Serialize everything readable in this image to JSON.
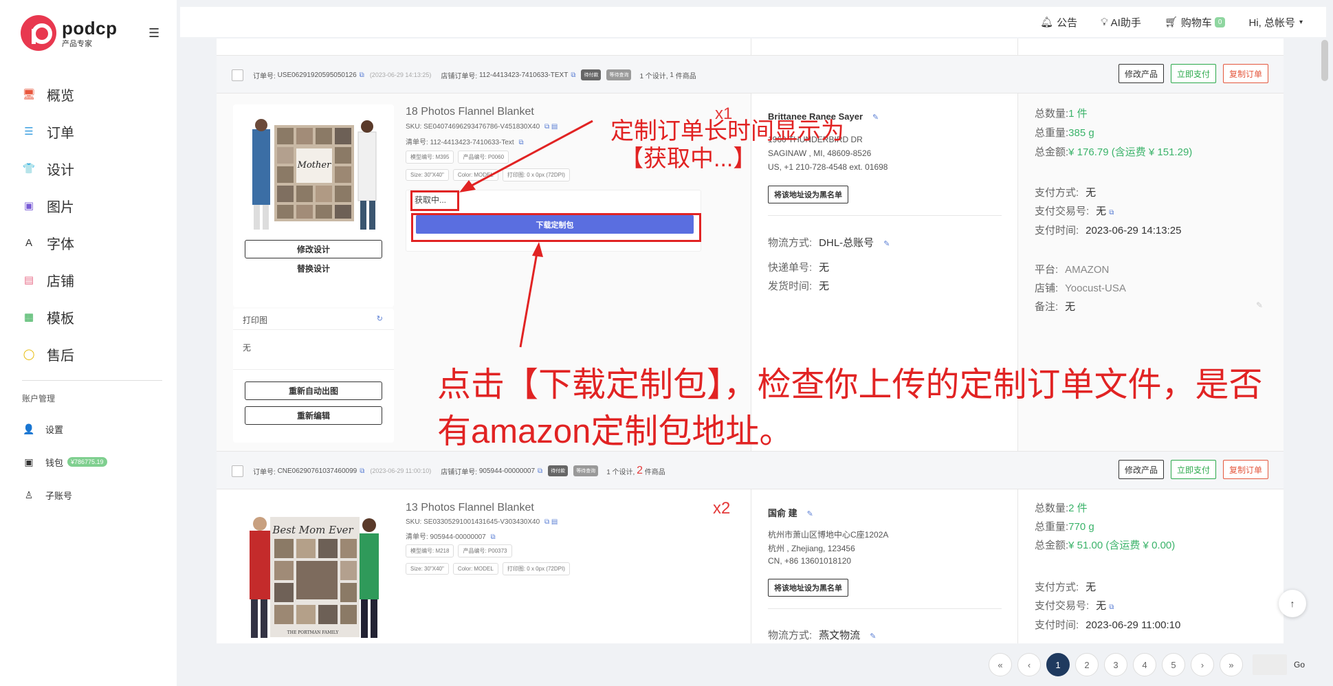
{
  "app": {
    "name": "podcp",
    "subtitle": "产品专家"
  },
  "sidebar": {
    "items": [
      {
        "label": "概览",
        "icon": "monitor-icon",
        "color": "#e8573d"
      },
      {
        "label": "订单",
        "icon": "list-icon",
        "color": "#3b9fe0"
      },
      {
        "label": "设计",
        "icon": "shirt-icon",
        "color": "#e0432d"
      },
      {
        "label": "图片",
        "icon": "image-icon",
        "color": "#7a5cd6"
      },
      {
        "label": "字体",
        "icon": "font-icon",
        "color": "#333333"
      },
      {
        "label": "店铺",
        "icon": "store-icon",
        "color": "#e86f8a"
      },
      {
        "label": "模板",
        "icon": "template-icon",
        "color": "#2aa84a"
      },
      {
        "label": "售后",
        "icon": "chat-icon",
        "color": "#e6b800"
      }
    ],
    "account_title": "账户管理",
    "account_items": [
      {
        "label": "设置",
        "icon": "user-icon"
      },
      {
        "label": "钱包",
        "icon": "wallet-icon",
        "badge": "¥786775.19"
      },
      {
        "label": "子账号",
        "icon": "sub-account-icon"
      }
    ]
  },
  "header": {
    "notice": "公告",
    "ai": "AI助手",
    "cart": "购物车",
    "cart_count": "0",
    "user": "Hi, 总帐号"
  },
  "orders": [
    {
      "order_no_label": "订单号:",
      "order_no": "USE06291920595050126",
      "time": "(2023-06-29 14:13:25)",
      "store_order_label": "店铺订单号:",
      "store_order": "112-4413423-7410633-TEXT",
      "tag1": "待付款",
      "tag2": "等待查询",
      "design_count": "1 个设计,",
      "item_count": "1",
      "item_suffix": "件商品",
      "btn_edit": "修改产品",
      "btn_pay": "立即支付",
      "btn_copy": "复制订单",
      "product": {
        "title": "18 Photos Flannel Blanket",
        "sku": "SKU: SE04074696293476786-V451830X40",
        "list_no": "清单号: 112-4413423-7410633-Text",
        "template_no": "模型编号: M395",
        "product_no": "产品编号: P0060",
        "size": "Size: 30\"X40\"",
        "color": "Color: MODEL",
        "print": "打印图: 0 x 0px (72DPI)",
        "qty": "x1",
        "fetching": "获取中...",
        "download": "下载定制包",
        "edit_design": "修改设计",
        "replace_design": "替换设计",
        "print_image_label": "打印图",
        "print_image_value": "无",
        "regen": "重新自动出图",
        "reedit": "重新编辑"
      },
      "address": {
        "name": "Brittanee Ranee Sayer",
        "line1": "1960 THUNDERBIRD DR",
        "line2": "SAGINAW , MI, 48609-8526",
        "line3": "US, +1 210-728-4548 ext. 01698",
        "blacklist": "将该地址设为黑名单",
        "ship_label": "物流方式:",
        "ship_value": "DHL-总账号",
        "track_label": "快递单号:",
        "track_value": "无",
        "send_label": "发货时间:",
        "send_value": "无"
      },
      "summary": {
        "qty_label": "总数量:",
        "qty_value": "1 件",
        "weight_label": "总重量:",
        "weight_value": "385 g",
        "amount_label": "总金额:",
        "amount_value": "¥ 176.79",
        "shipping_value": "(含运费 ¥ 151.29)",
        "pay_method_label": "支付方式:",
        "pay_method_value": "无",
        "pay_tx_label": "支付交易号:",
        "pay_tx_value": "无",
        "pay_time_label": "支付时间:",
        "pay_time_value": "2023-06-29 14:13:25",
        "platform_label": "平台:",
        "platform_value": "AMAZON",
        "store_label": "店铺:",
        "store_value": "Yoocust-USA",
        "note_label": "备注:",
        "note_value": "无"
      }
    },
    {
      "order_no_label": "订单号:",
      "order_no": "CNE06290761037460099",
      "time": "(2023-06-29 11:00:10)",
      "store_order_label": "店铺订单号:",
      "store_order": "905944-00000007",
      "tag1": "待付款",
      "tag2": "等待查询",
      "design_count": "1 个设计,",
      "item_count": "2",
      "item_suffix": "件商品",
      "btn_edit": "修改产品",
      "btn_pay": "立即支付",
      "btn_copy": "复制订单",
      "product": {
        "title": "13 Photos Flannel Blanket",
        "sku": "SKU: SE03305291001431645-V303430X40",
        "list_no": "清单号: 905944-00000007",
        "template_no": "模型编号: M218",
        "product_no": "产品编号: P00373",
        "size": "Size: 30\"X40\"",
        "color": "Color: MODEL",
        "print": "打印图: 0 x 0px (72DPI)",
        "qty": "x2"
      },
      "address": {
        "name": "国俞 建",
        "line1": "杭州市萧山区博地中心C座1202A",
        "line2": "杭州 , Zhejiang, 123456",
        "line3": "CN, +86 13601018120",
        "blacklist": "将该地址设为黑名单",
        "ship_label": "物流方式:",
        "ship_value": "燕文物流"
      },
      "summary": {
        "qty_label": "总数量:",
        "qty_value": "2 件",
        "weight_label": "总重量:",
        "weight_value": "770 g",
        "amount_label": "总金额:",
        "amount_value": "¥ 51.00",
        "shipping_value": "(含运费 ¥ 0.00)",
        "pay_method_label": "支付方式:",
        "pay_method_value": "无",
        "pay_tx_label": "支付交易号:",
        "pay_tx_value": "无",
        "pay_time_label": "支付时间:",
        "pay_time_value": "2023-06-29 11:00:10"
      }
    }
  ],
  "annotations": {
    "top_line1": "定制订单长时间显示为",
    "top_line2": "【获取中...】",
    "bottom_line1": "点击【下载定制包】，检查你上传的定制订单文件，是否",
    "bottom_line2": "有amazon定制包地址。"
  },
  "pagination": {
    "first": "«",
    "prev": "‹",
    "pages": [
      "1",
      "2",
      "3",
      "4",
      "5"
    ],
    "next": "›",
    "last": "»",
    "go": "Go",
    "current": "1"
  }
}
